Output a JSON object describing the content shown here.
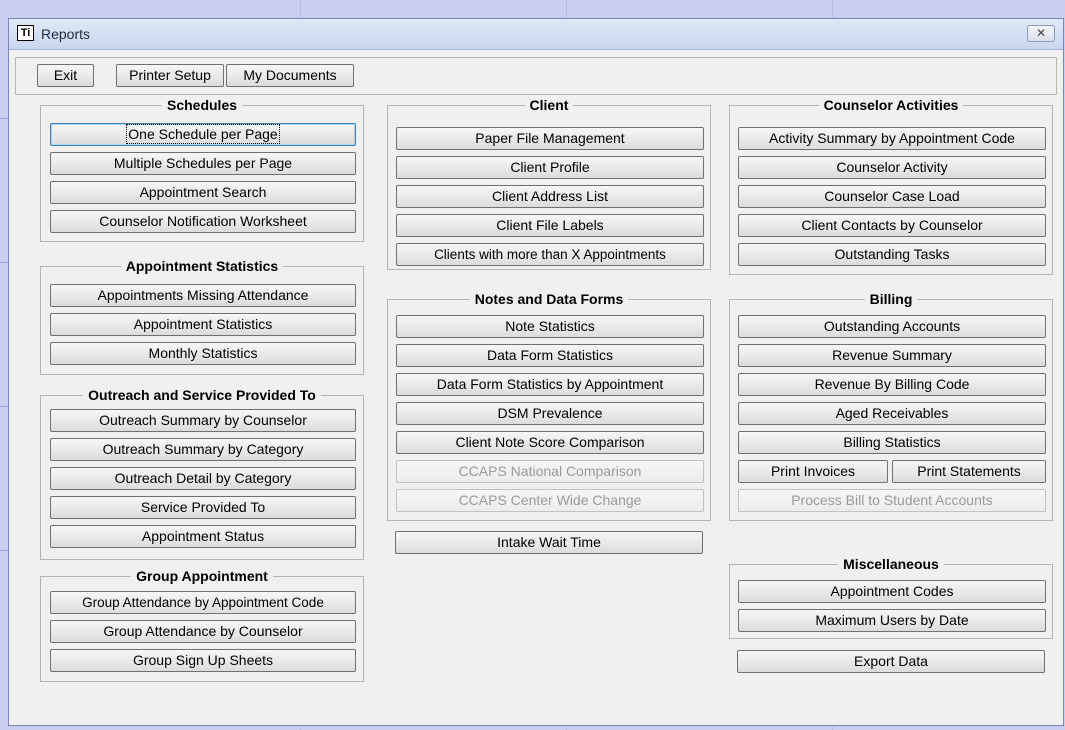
{
  "window": {
    "title": "Reports",
    "icon_text": "Ti",
    "close_glyph": "✕"
  },
  "toolbar": {
    "exit": "Exit",
    "printer_setup": "Printer Setup",
    "my_documents": "My Documents"
  },
  "schedules": {
    "title": "Schedules",
    "items": [
      "One Schedule per Page",
      "Multiple Schedules per Page",
      "Appointment Search",
      "Counselor Notification Worksheet"
    ]
  },
  "appointment_statistics": {
    "title": "Appointment Statistics",
    "items": [
      "Appointments Missing Attendance",
      "Appointment Statistics",
      "Monthly Statistics"
    ]
  },
  "outreach": {
    "title": "Outreach and Service Provided To",
    "items": [
      "Outreach Summary by Counselor",
      "Outreach Summary by Category",
      "Outreach Detail by Category",
      "Service Provided To",
      "Appointment Status"
    ]
  },
  "group_appointment": {
    "title": "Group Appointment",
    "items": [
      "Group Attendance by Appointment Code",
      "Group Attendance by Counselor",
      "Group Sign Up Sheets"
    ]
  },
  "client": {
    "title": "Client",
    "items": [
      "Paper File Management",
      "Client Profile",
      "Client Address List",
      "Client File Labels",
      "Clients with more than X Appointments"
    ]
  },
  "notes": {
    "title": "Notes  and Data Forms",
    "items": [
      "Note Statistics",
      "Data Form Statistics",
      "Data Form Statistics by Appointment",
      "DSM Prevalence",
      "Client Note Score Comparison",
      "CCAPS National Comparison",
      "CCAPS Center Wide Change"
    ]
  },
  "intake_wait_time": "Intake Wait Time",
  "counselor_activities": {
    "title": "Counselor Activities",
    "items": [
      "Activity Summary by Appointment Code",
      "Counselor Activity",
      "Counselor Case Load",
      "Client Contacts by Counselor",
      "Outstanding Tasks"
    ]
  },
  "billing": {
    "title": "Billing",
    "items": [
      "Outstanding Accounts",
      "Revenue Summary",
      "Revenue By Billing Code",
      "Aged Receivables",
      "Billing Statistics"
    ],
    "print_invoices": "Print Invoices",
    "print_statements": "Print Statements",
    "process_bill": "Process Bill to Student Accounts"
  },
  "miscellaneous": {
    "title": "Miscellaneous",
    "items": [
      "Appointment Codes",
      "Maximum Users by Date"
    ]
  },
  "export_data": "Export Data"
}
